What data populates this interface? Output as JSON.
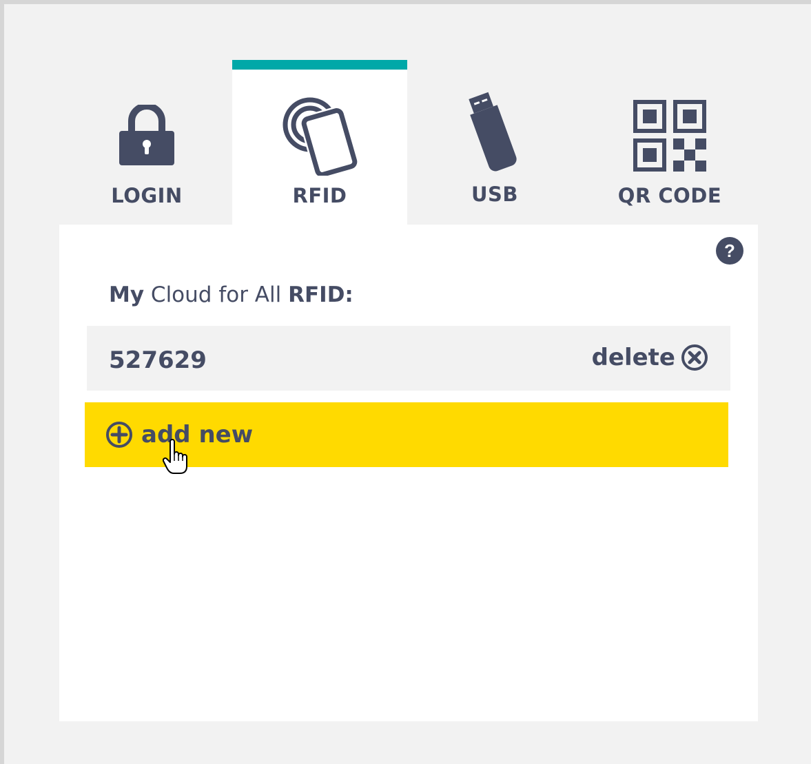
{
  "tabs": [
    {
      "label": "LOGIN",
      "icon": "lock-icon",
      "active": false
    },
    {
      "label": "RFID",
      "icon": "rfid-card-icon",
      "active": true
    },
    {
      "label": "USB",
      "icon": "usb-stick-icon",
      "active": false
    },
    {
      "label": "QR CODE",
      "icon": "qr-code-icon",
      "active": false
    }
  ],
  "panel": {
    "title_my": "My",
    "title_mid": "Cloud for All",
    "title_rfid": "RFID:",
    "rfid_entries": [
      {
        "value": "527629",
        "delete_label": "delete"
      }
    ],
    "add_new_label": "add new"
  },
  "colors": {
    "accent": "#00a8a8",
    "add_button": "#ffda00",
    "text": "#454c64",
    "background": "#f2f2f2"
  }
}
